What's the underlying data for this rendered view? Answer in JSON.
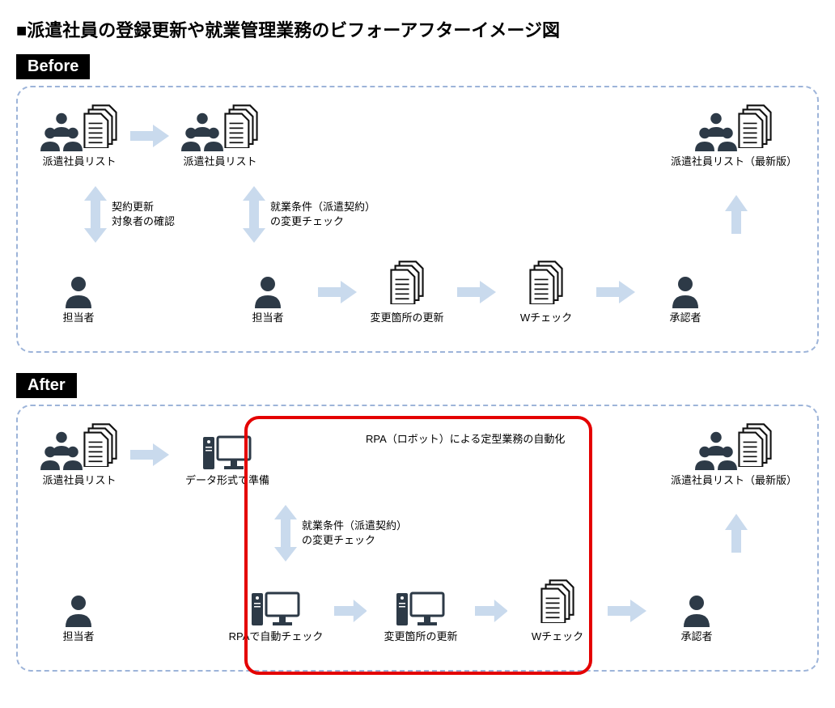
{
  "title": "■派遣社員の登録更新や就業管理業務のビフォーアフターイメージ図",
  "labels": {
    "before": "Before",
    "after": "After"
  },
  "before": {
    "row1": {
      "n1": "派遣社員リスト",
      "n2": "派遣社員リスト",
      "n3": "派遣社員リスト（最新版）"
    },
    "v1": "契約更新\n対象者の確認",
    "v2": "就業条件（派遣契約）\nの変更チェック",
    "row2": {
      "n1": "担当者",
      "n2": "担当者",
      "n3": "変更箇所の更新",
      "n4": "Wチェック",
      "n5": "承認者"
    }
  },
  "after": {
    "rpa_caption": "RPA（ロボット）による定型業務の自動化",
    "row1": {
      "n1": "派遣社員リスト",
      "n2": "データ形式で準備",
      "n3": "派遣社員リスト（最新版）"
    },
    "v2": "就業条件（派遣契約）\nの変更チェック",
    "row2": {
      "n1": "担当者",
      "n2": "RPAで自動チェック",
      "n3": "変更箇所の更新",
      "n4": "Wチェック",
      "n5": "承認者"
    }
  }
}
